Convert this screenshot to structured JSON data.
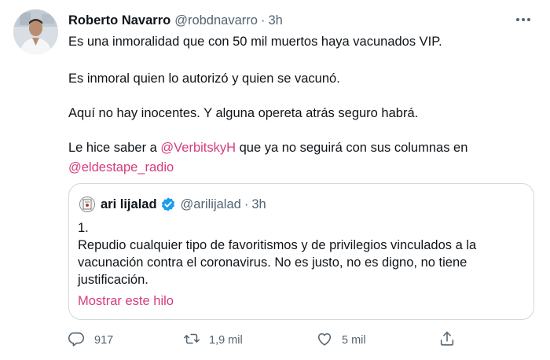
{
  "tweet": {
    "author_name": "Roberto Navarro",
    "author_handle": "@robdnavarro",
    "separator": "·",
    "time": "3h",
    "paragraphs": {
      "p1": "Es una inmoralidad que con 50 mil muertos haya vacunados VIP.",
      "p2": "Es inmoral quien lo autorizó y quien se vacunó.",
      "p3": "Aquí no hay inocentes. Y alguna opereta atrás seguro habrá.",
      "p4_before": "Le hice saber a ",
      "p4_mention": "@VerbitskyH",
      "p4_after": " que ya no seguirá con sus columnas en",
      "p5_mention": "@eldestape_radio"
    }
  },
  "quoted": {
    "author_name": "ari lijalad",
    "author_handle": "@arilijalad",
    "separator": "·",
    "time": "3h",
    "lines": [
      "1.",
      "Repudio cualquier tipo de favoritismos y de privilegios vinculados a la",
      "vacunación contra el coronavirus. No es justo, no es digno, no tiene",
      "justificación."
    ],
    "show_thread": "Mostrar este hilo"
  },
  "actions": {
    "reply_count": "917",
    "retweet_count": "1,9 mil",
    "like_count": "5 mil"
  },
  "colors": {
    "accent": "#d63b7b",
    "secondary_text": "#536471",
    "verified": "#1d9bf0"
  },
  "icons": {
    "more": "more-horizontal-icon",
    "verified": "verified-badge-icon",
    "reply": "reply-icon",
    "retweet": "retweet-icon",
    "like": "heart-icon",
    "share": "share-icon"
  }
}
